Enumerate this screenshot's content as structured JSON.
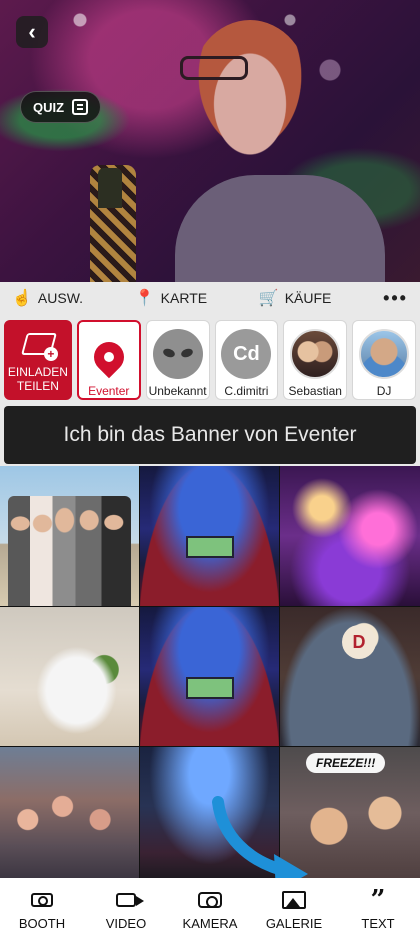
{
  "hero": {
    "quiz_label": "QUIZ"
  },
  "toolbar": {
    "items": [
      {
        "label": "AUSW.",
        "icon": "hand-pointer-icon"
      },
      {
        "label": "KARTE",
        "icon": "map-pin-icon"
      },
      {
        "label": "KÄUFE",
        "icon": "cart-icon"
      }
    ],
    "more_icon": "more-dots-icon"
  },
  "stories": {
    "invite": {
      "label_line1": "EINLADEN",
      "label_line2": "TEILEN"
    },
    "items": [
      {
        "label": "Eventer",
        "selected": true
      },
      {
        "label": "Unbekannt"
      },
      {
        "label": "C.dimitri",
        "initials": "Cd"
      },
      {
        "label": "Sebastian"
      },
      {
        "label": "DJ"
      }
    ]
  },
  "banner": {
    "text": "Ich bin das Banner von Eventer"
  },
  "gallery": {
    "freeze_text": "FREEZE!!!",
    "ball_letter": "D"
  },
  "bottom_nav": {
    "items": [
      {
        "label": "BOOTH"
      },
      {
        "label": "VIDEO"
      },
      {
        "label": "KAMERA"
      },
      {
        "label": "GALERIE"
      },
      {
        "label": "TEXT"
      }
    ]
  },
  "colors": {
    "accent_red": "#d10f2d",
    "invite_red": "#c3112a",
    "arrow_blue": "#1e90d8"
  }
}
